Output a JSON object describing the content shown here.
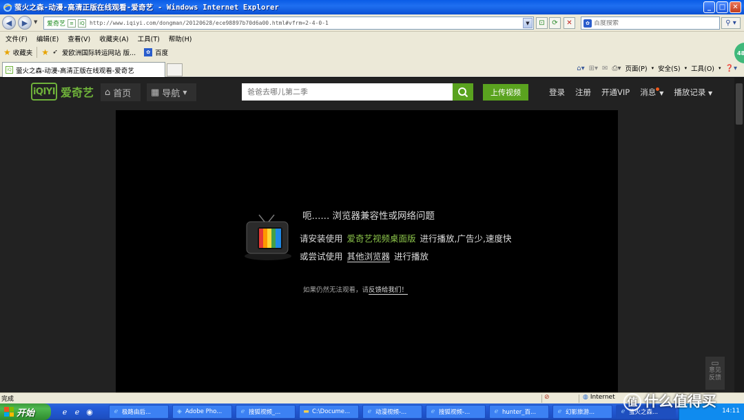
{
  "window": {
    "title": "萤火之森-动漫-高清正版在线观看-爱奇艺 - Windows Internet Explorer",
    "controls": {
      "minimize": "_",
      "maximize": "□",
      "close": "✕"
    }
  },
  "address_bar": {
    "site_tag": "爱奇艺",
    "url": "http://www.iqiyi.com/dongman/20120628/ece98897b70d6a00.html#vfrm=2-4-0-1",
    "search_placeholder": "百度搜索"
  },
  "menu": [
    "文件(F)",
    "编辑(E)",
    "查看(V)",
    "收藏夹(A)",
    "工具(T)",
    "帮助(H)"
  ],
  "favorites_bar": {
    "favorites_label": "收藏夹",
    "items": [
      {
        "label": "爱欧洲国际转运网站 版...",
        "icon": "bookmark-icon"
      },
      {
        "label": "百度",
        "icon": "baidu-icon"
      }
    ]
  },
  "tabs": [
    {
      "label": "萤火之森-动漫-高清正版在线观看-爱奇艺"
    }
  ],
  "command_bar": {
    "page": "页面(P)",
    "safety": "安全(S)",
    "tools": "工具(O)"
  },
  "site_header": {
    "logo_box": "iQIYI",
    "logo_text": "爱奇艺",
    "home": "首页",
    "nav": "导航",
    "search_placeholder": "爸爸去哪儿第二季",
    "upload": "上传视频",
    "links": {
      "login": "登录",
      "register": "注册",
      "vip": "开通VIP",
      "messages": "消息",
      "history": "播放记录"
    }
  },
  "player_error": {
    "title": "呃......  浏览器兼容性或网络问题",
    "line1_prefix": "请安装使用",
    "line1_link": "爱奇艺视频桌面版",
    "line1_suffix": "进行播放,广告少,速度快",
    "line2_prefix": "或尝试使用",
    "line2_link": "其他浏览器",
    "line2_suffix": "进行播放",
    "feedback_prefix": "如果仍然无法观看，请",
    "feedback_link": "反馈给我们！"
  },
  "feedback_float": {
    "line1": "意见",
    "line2": "反馈"
  },
  "status_bar": {
    "status": "完成",
    "zone": "Internet"
  },
  "side_badge": "48",
  "taskbar": {
    "start": "开始",
    "tasks": [
      "极路由后...",
      "Adobe Pho...",
      "搜狐视频_...",
      "C:\\Docume...",
      "动漫视频-...",
      "搜狐视频-...",
      "hunter_百...",
      "幻影旅游...",
      "萤火之森..."
    ],
    "clock": "14:11"
  },
  "watermark": "什么值得买",
  "colors": {
    "brand_green": "#5aa31f",
    "xp_blue": "#0a5ce6"
  }
}
